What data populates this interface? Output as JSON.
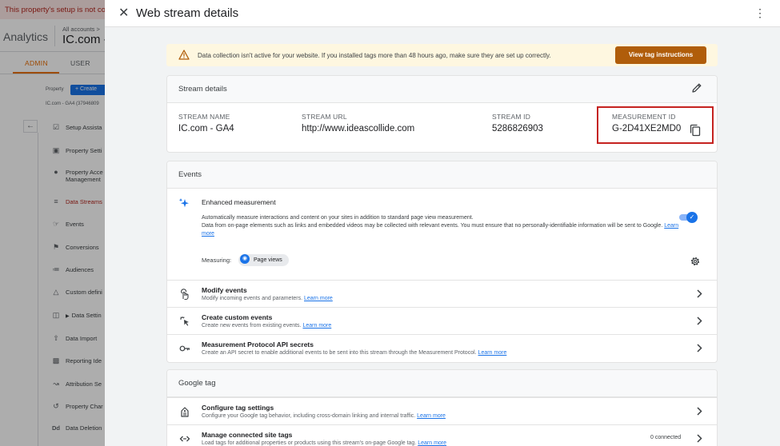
{
  "background": {
    "setup_banner": "This property's setup is not com",
    "app_title": "Analytics",
    "account_crumb": "All accounts >",
    "account_name": "IC.com -",
    "tabs": [
      "ADMIN",
      "USER"
    ],
    "property_label": "Property",
    "create_label": "+ Create",
    "property_sub": "IC.com - GA4 (37946809",
    "nav_items": [
      {
        "label": "Setup Assista",
        "icon": "checklist-icon"
      },
      {
        "label": "Property Setti",
        "icon": "property-settings-icon"
      },
      {
        "label": "Property Acce",
        "label2": "Management",
        "icon": "people-icon"
      },
      {
        "label": "Data Streams",
        "icon": "data-streams-icon",
        "active": true
      },
      {
        "label": "Events",
        "icon": "touch-icon"
      },
      {
        "label": "Conversions",
        "icon": "flag-icon"
      },
      {
        "label": "Audiences",
        "icon": "audiences-icon"
      },
      {
        "label": "Custom defini",
        "icon": "shapes-icon"
      },
      {
        "label": "Data Settin",
        "icon": "database-icon"
      },
      {
        "label": "Data Import",
        "icon": "upload-icon"
      },
      {
        "label": "Reporting Ide",
        "icon": "reporting-icon"
      },
      {
        "label": "Attribution Se",
        "icon": "attribution-icon"
      },
      {
        "label": "Property Char",
        "icon": "history-icon"
      },
      {
        "label": "Data Deletion",
        "icon": "dd-icon"
      }
    ]
  },
  "panel": {
    "title": "Web stream details",
    "warning_text": "Data collection isn't active for your website. If you installed tags more than 48 hours ago, make sure they are set up correctly.",
    "warning_button": "View tag instructions",
    "stream_details": {
      "title": "Stream details",
      "name_label": "STREAM NAME",
      "name_value": "IC.com - GA4",
      "url_label": "STREAM URL",
      "url_value": "http://www.ideascollide.com",
      "id_label": "STREAM ID",
      "id_value": "5286826903",
      "mid_label": "MEASUREMENT ID",
      "mid_value": "G-2D41XE2MD0"
    },
    "events": {
      "title": "Events",
      "enhanced_title": "Enhanced measurement",
      "enhanced_desc_1": "Automatically measure interactions and content on your sites in addition to standard page view measurement.",
      "enhanced_desc_2": "Data from on-page elements such as links and embedded videos may be collected with relevant events. You must ensure that no personally-identifiable information will be sent to Google.",
      "learn_more": "Learn more",
      "enhanced_enabled": true,
      "measuring_label": "Measuring:",
      "measuring_chip": "Page views",
      "rows": [
        {
          "title": "Modify events",
          "desc": "Modify incoming events and parameters.",
          "link": "Learn more",
          "icon": "touch-icon"
        },
        {
          "title": "Create custom events",
          "desc": "Create new events from existing events.",
          "link": "Learn more",
          "icon": "sparkle-click-icon"
        },
        {
          "title": "Measurement Protocol API secrets",
          "desc": "Create an API secret to enable additional events to be sent into this stream through the Measurement Protocol.",
          "link": "Learn more",
          "icon": "key-icon"
        }
      ]
    },
    "google_tag": {
      "title": "Google tag",
      "rows": [
        {
          "title": "Configure tag settings",
          "desc": "Configure your Google tag behavior, including cross-domain linking and internal traffic.",
          "link": "Learn more",
          "icon": "tag-icon"
        },
        {
          "title": "Manage connected site tags",
          "desc": "Load tags for additional properties or products using this stream's on-page Google tag.",
          "link": "Learn more",
          "icon": "code-icon",
          "badge": "0 connected"
        }
      ]
    }
  },
  "colors": {
    "accent": "#1a73e8",
    "warning_button": "#b05d0a",
    "highlight_box": "#c5221f",
    "admin_tab": "#e8710a"
  }
}
